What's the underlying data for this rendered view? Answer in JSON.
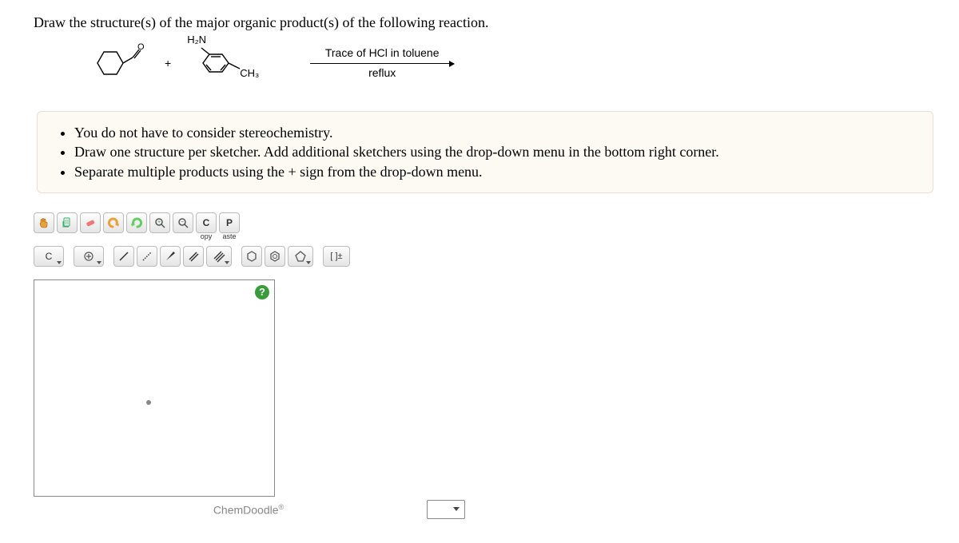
{
  "question": {
    "prompt": "Draw the structure(s) of the major organic product(s) of the following reaction."
  },
  "reaction": {
    "plus": "+",
    "reactant2_label_top": "H₂N",
    "reactant2_label_bottom": "CH₃",
    "condition_top": "Trace of HCl in toluene",
    "condition_bottom": "reflux"
  },
  "instructions": {
    "item1": "You do not have to consider stereochemistry.",
    "item2": "Draw one structure per sketcher. Add additional sketchers using the drop-down menu in the bottom right corner.",
    "item3": "Separate multiple products using the + sign from the drop-down menu."
  },
  "toolbar": {
    "copy_label_top": "C",
    "copy_label_bottom": "opy",
    "paste_label_top": "P",
    "paste_label_bottom": "aste",
    "element_button": "C",
    "charge_button": "[ ]±"
  },
  "sketcher": {
    "help": "?",
    "brand": "ChemDoodle",
    "brand_mark": "®"
  }
}
